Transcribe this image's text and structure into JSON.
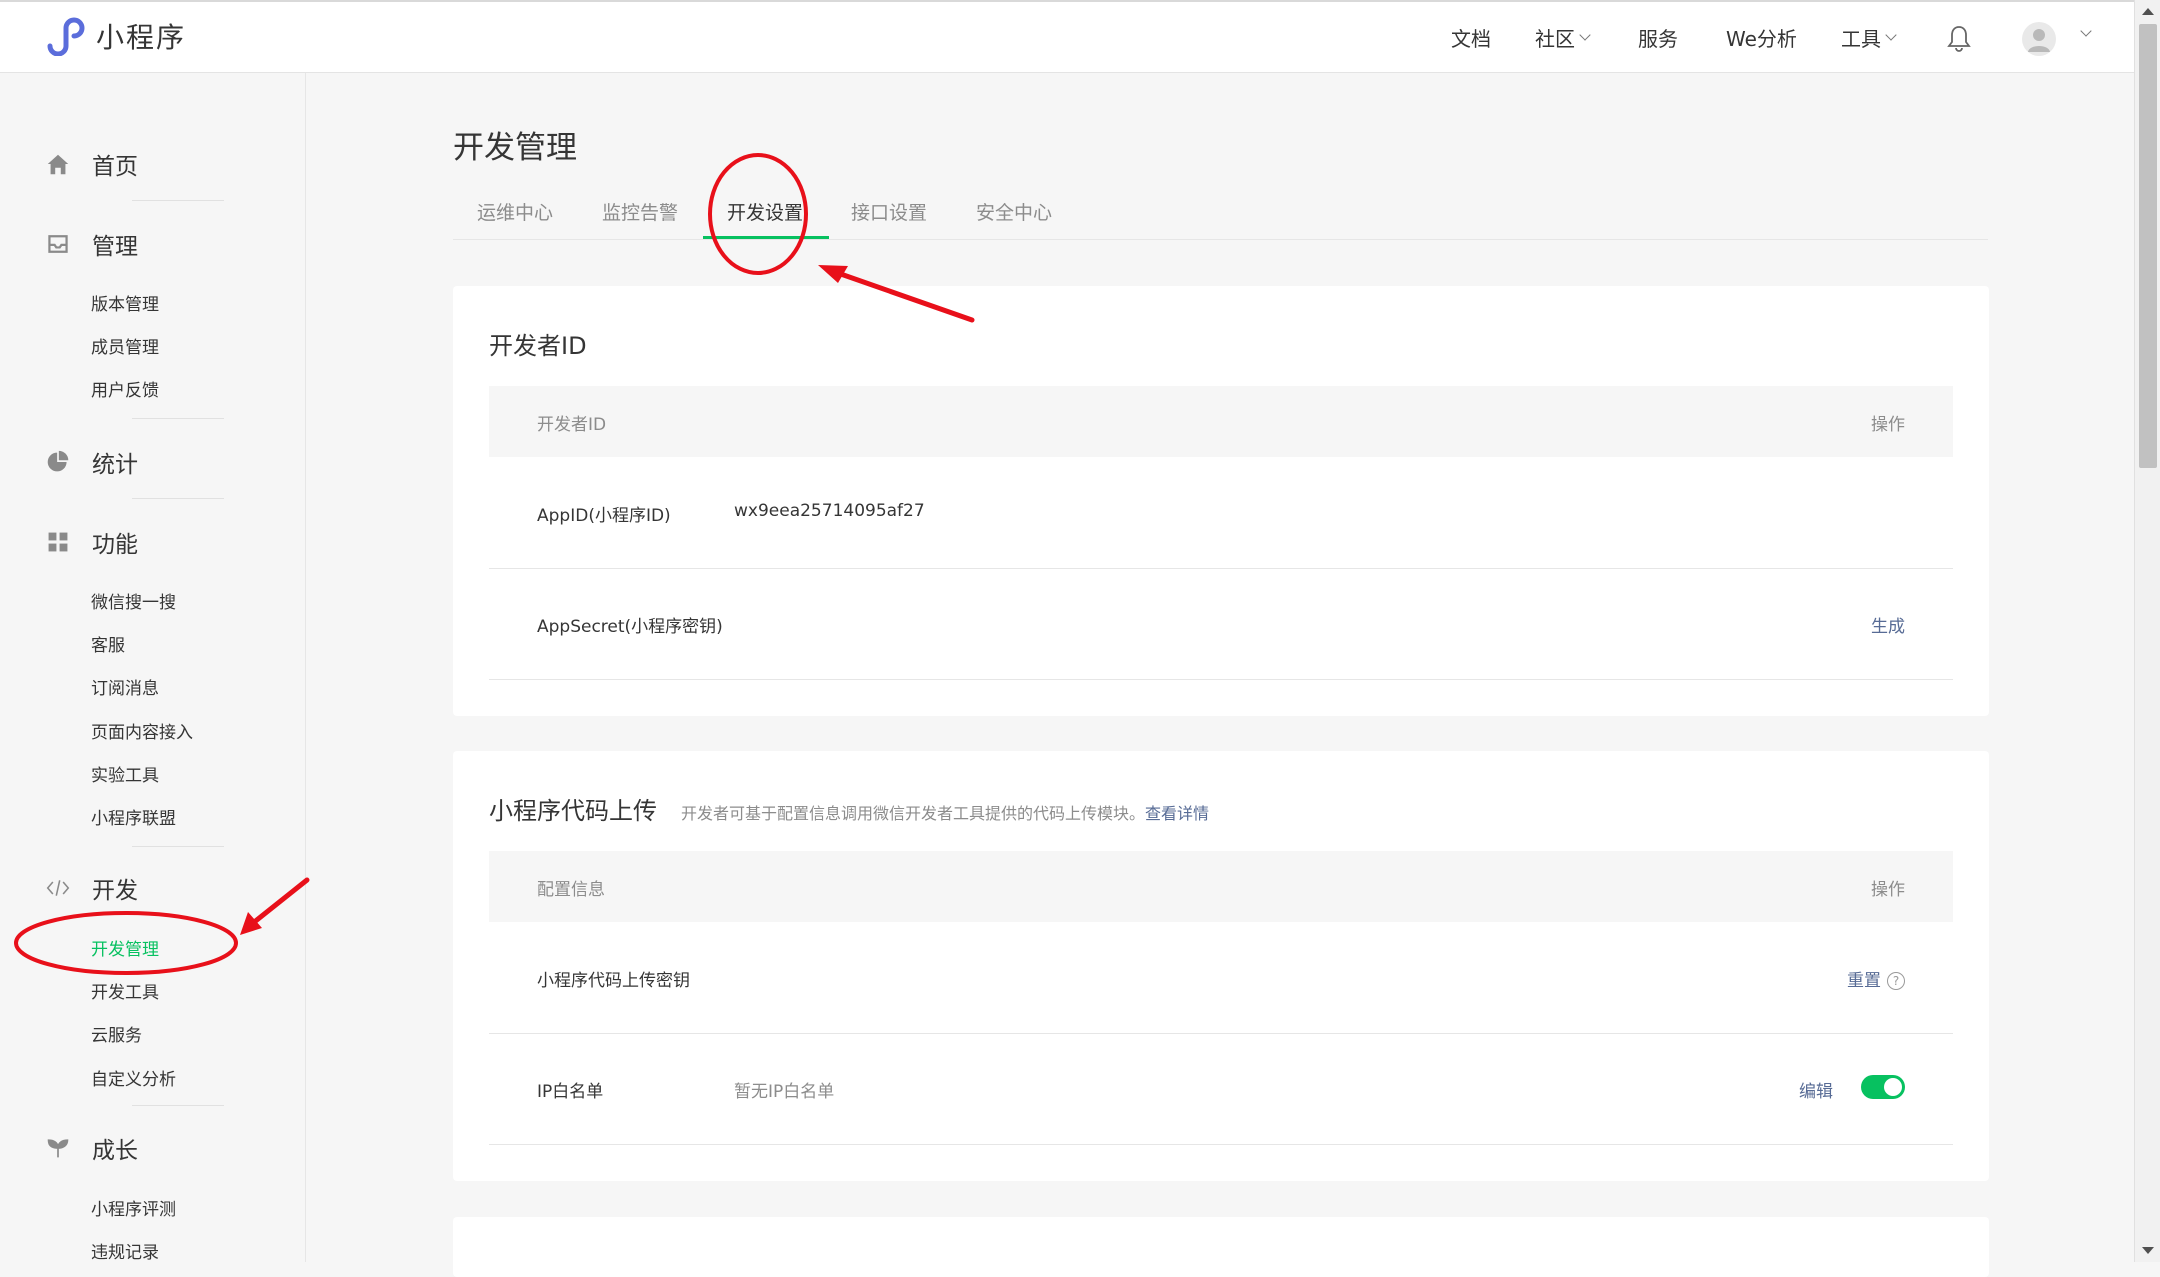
{
  "header": {
    "app_name": "小程序",
    "nav": [
      "文档",
      "社区",
      "服务",
      "We分析",
      "工具"
    ]
  },
  "sidebar": {
    "home": "首页",
    "manage": {
      "label": "管理",
      "items": [
        "版本管理",
        "成员管理",
        "用户反馈"
      ]
    },
    "stats": "统计",
    "features": {
      "label": "功能",
      "items": [
        "微信搜一搜",
        "客服",
        "订阅消息",
        "页面内容接入",
        "实验工具",
        "小程序联盟"
      ]
    },
    "dev": {
      "label": "开发",
      "items": [
        "开发管理",
        "开发工具",
        "云服务",
        "自定义分析"
      ]
    },
    "growth": {
      "label": "成长",
      "items": [
        "小程序评测",
        "违规记录"
      ]
    }
  },
  "main": {
    "title": "开发管理",
    "tabs": [
      "运维中心",
      "监控告警",
      "开发设置",
      "接口设置",
      "安全中心"
    ],
    "dev_id_card": {
      "title": "开发者ID",
      "col_left": "开发者ID",
      "col_right": "操作",
      "appid_label": "AppID(小程序ID)",
      "appid_value": "wx9eea25714095af27",
      "secret_label": "AppSecret(小程序密钥)",
      "secret_action": "生成"
    },
    "upload_card": {
      "title": "小程序代码上传",
      "desc": "开发者可基于配置信息调用微信开发者工具提供的代码上传模块。",
      "desc_link": "查看详情",
      "col_left": "配置信息",
      "col_right": "操作",
      "key_label": "小程序代码上传密钥",
      "key_action": "重置",
      "help_mark": "?",
      "ip_label": "IP白名单",
      "ip_value": "暂无IP白名单",
      "ip_action": "编辑"
    }
  },
  "colors": {
    "accent_green": "#07c160",
    "link_blue": "#576b95",
    "annotation_red": "#e8101a"
  }
}
